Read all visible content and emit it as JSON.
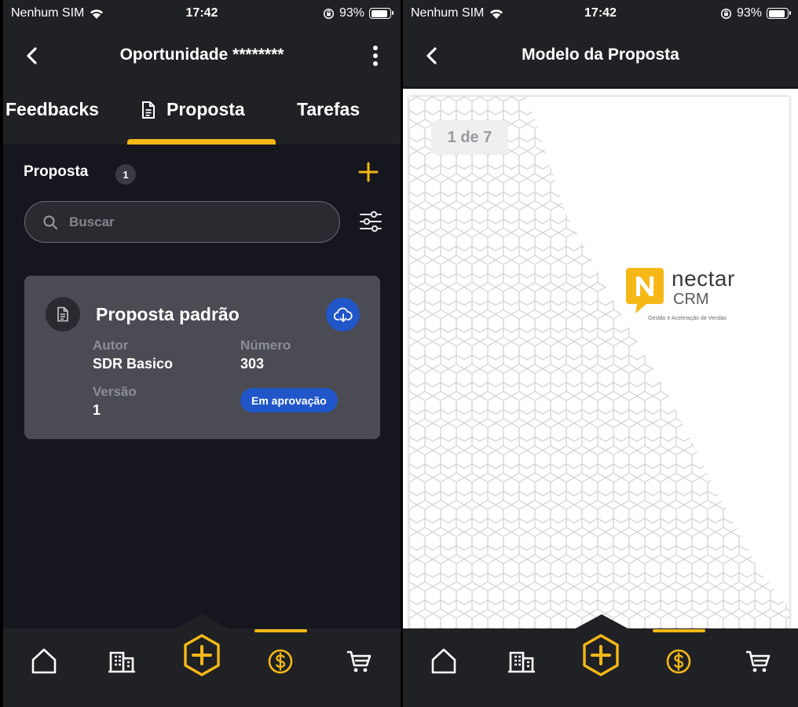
{
  "status": {
    "carrier": "Nenhum SIM",
    "time": "17:42",
    "battery": "93%"
  },
  "left": {
    "header_title": "Oportunidade ********",
    "tabs": [
      {
        "label": "Feedbacks"
      },
      {
        "label": "Proposta",
        "active": true
      },
      {
        "label": "Tarefas"
      }
    ],
    "section_title": "Proposta",
    "section_count": "1",
    "search_placeholder": "Buscar",
    "card": {
      "title": "Proposta padrão",
      "autor_label": "Autor",
      "autor_value": "SDR Basico",
      "numero_label": "Número",
      "numero_value": "303",
      "versao_label": "Versão",
      "versao_value": "1",
      "status": "Em aprovação"
    }
  },
  "right": {
    "header_title": "Modelo da Proposta",
    "page_counter": "1 de 7",
    "logo_word": "nectar",
    "logo_crm": "CRM",
    "logo_tagline": "Gestão e Aceleração de Vendas"
  },
  "nav": {
    "items": [
      "home-icon",
      "buildings-icon",
      "add-hexagon-icon",
      "dollar-icon",
      "cart-icon"
    ],
    "active_index": 3
  },
  "colors": {
    "accent": "#f5b817",
    "primary_blue": "#2156c8",
    "background": "#15161e",
    "surface": "#202125",
    "card": "#4a4b53"
  }
}
